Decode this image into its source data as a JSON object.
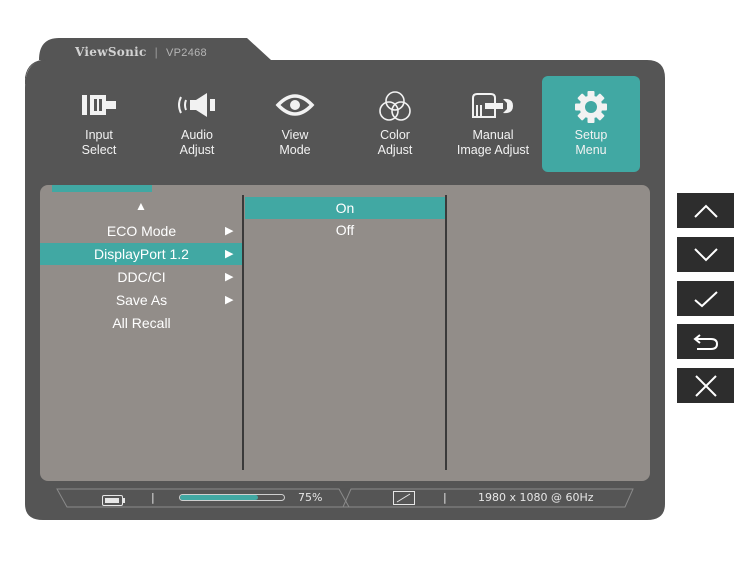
{
  "brand": {
    "name": "ViewSonic",
    "separator": "|",
    "model": "VP2468"
  },
  "tabs": [
    {
      "label_line1": "Input",
      "label_line2": "Select",
      "icon": "input-select-icon",
      "active": false
    },
    {
      "label_line1": "Audio",
      "label_line2": "Adjust",
      "icon": "speaker-icon",
      "active": false
    },
    {
      "label_line1": "View",
      "label_line2": "Mode",
      "icon": "eye-icon",
      "active": false
    },
    {
      "label_line1": "Color",
      "label_line2": "Adjust",
      "icon": "color-circles-icon",
      "active": false
    },
    {
      "label_line1": "Manual",
      "label_line2": "Image Adjust",
      "icon": "wrench-icon",
      "active": false
    },
    {
      "label_line1": "Setup",
      "label_line2": "Menu",
      "icon": "gear-icon",
      "active": true
    }
  ],
  "menu": {
    "scroll_up_glyph": "▲",
    "arrow_glyph": "▶",
    "items": [
      {
        "label": "ECO Mode",
        "has_submenu": true,
        "selected": false
      },
      {
        "label": "DisplayPort 1.2",
        "has_submenu": true,
        "selected": true
      },
      {
        "label": "DDC/CI",
        "has_submenu": true,
        "selected": false
      },
      {
        "label": "Save As",
        "has_submenu": true,
        "selected": false
      },
      {
        "label": "All Recall",
        "has_submenu": false,
        "selected": false
      }
    ]
  },
  "submenu": {
    "items": [
      {
        "label": "On",
        "selected": true
      },
      {
        "label": "Off",
        "selected": false
      }
    ]
  },
  "status": {
    "separator": "|",
    "progress_percent": 75,
    "progress_label": "75%",
    "resolution": "1980 x 1080 @ 60Hz"
  },
  "keys": [
    "chevron-up-icon",
    "chevron-down-icon",
    "check-icon",
    "return-icon",
    "close-icon"
  ],
  "colors": {
    "accent": "#41a8a3",
    "frame": "#555555",
    "panel": "#928d89",
    "key": "#2d2d2d"
  }
}
